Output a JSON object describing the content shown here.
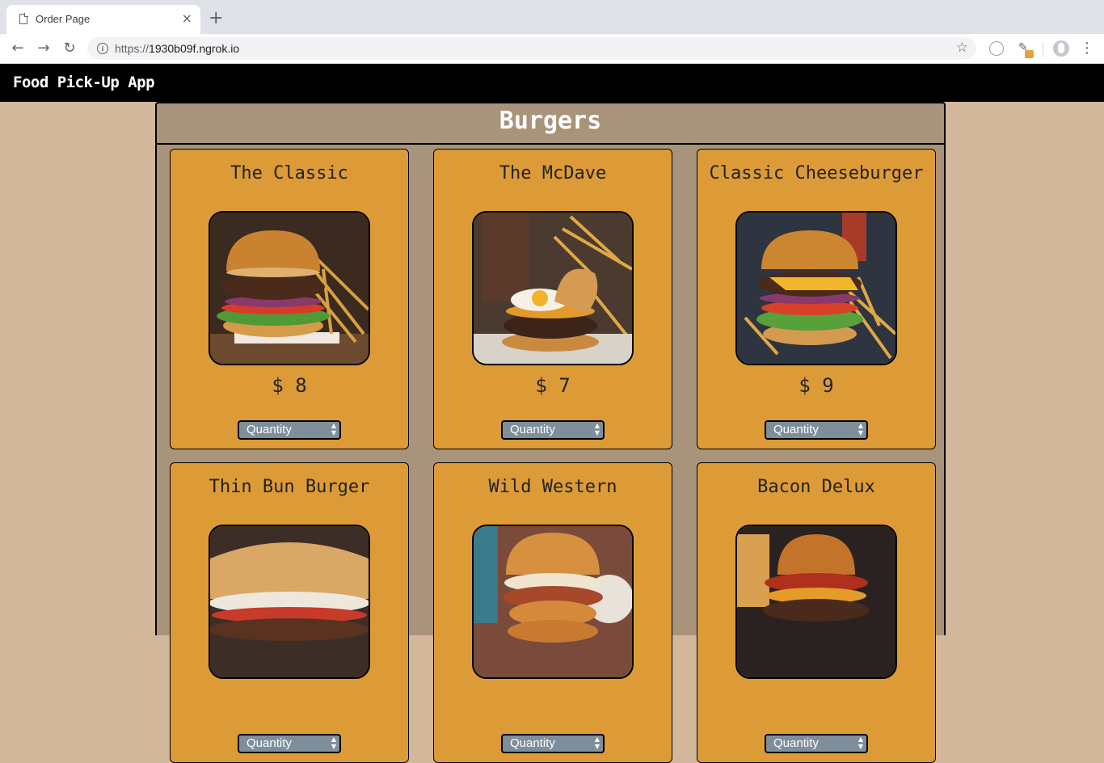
{
  "browser": {
    "tab_title": "Order Page",
    "tab_close": "×",
    "new_tab": "+",
    "url_scheme": "https://",
    "url_host": "1930b09f.ngrok.io",
    "back": "←",
    "forward": "→",
    "reload": "↻",
    "star": "☆",
    "menu": "⋮",
    "info": "i"
  },
  "app": {
    "title": "Food Pick-Up App"
  },
  "section": {
    "title": "Burgers"
  },
  "items": [
    {
      "name": "The Classic",
      "price": "$ 8",
      "quantity_label": "Quantity"
    },
    {
      "name": "The McDave",
      "price": "$ 7",
      "quantity_label": "Quantity"
    },
    {
      "name": "Classic Cheeseburger",
      "price": "$ 9",
      "quantity_label": "Quantity"
    },
    {
      "name": "Thin Bun Burger",
      "price": "",
      "quantity_label": "Quantity"
    },
    {
      "name": "Wild Western",
      "price": "",
      "quantity_label": "Quantity"
    },
    {
      "name": "Bacon Delux",
      "price": "",
      "quantity_label": "Quantity"
    }
  ],
  "colors": {
    "page_bg": "#d2b79a",
    "panel_bg": "#a8937b",
    "card_bg": "#dd9b38",
    "appbar_bg": "#000000",
    "select_bg": "#7f8e9b"
  }
}
